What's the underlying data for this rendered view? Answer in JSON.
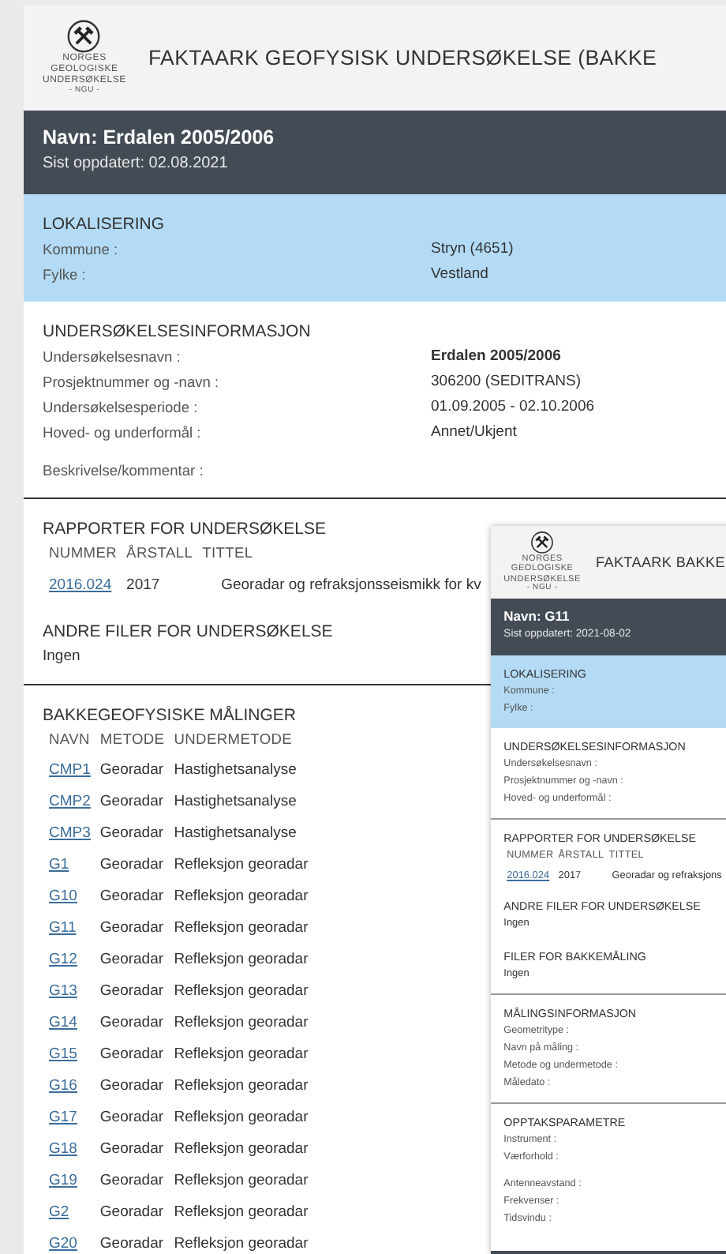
{
  "header": {
    "logo_lines": [
      "NORGES",
      "GEOLOGISKE",
      "UNDERSØKELSE",
      "- NGU -"
    ],
    "title": "FAKTAARK GEOFYSISK UNDERSØKELSE (BAKKE"
  },
  "name_bar": {
    "name": "Navn: Erdalen 2005/2006",
    "updated": "Sist oppdatert: 02.08.2021"
  },
  "location": {
    "heading": "LOKALISERING",
    "fields": [
      {
        "label": "Kommune :",
        "value": "Stryn (4651)",
        "bold": false
      },
      {
        "label": "Fylke :",
        "value": "Vestland",
        "bold": false
      }
    ]
  },
  "survey_info": {
    "heading": "UNDERSØKELSESINFORMASJON",
    "fields": [
      {
        "label": "Undersøkelsesnavn :",
        "value": "Erdalen 2005/2006",
        "bold": true
      },
      {
        "label": "Prosjektnummer og -navn :",
        "value": "306200 (SEDITRANS)",
        "bold": false
      },
      {
        "label": "Undersøkelsesperiode :",
        "value": "01.09.2005 - 02.10.2006",
        "bold": false
      },
      {
        "label": "Hoved- og underformål :",
        "value": "Annet/Ukjent",
        "bold": false
      }
    ],
    "description_label": "Beskrivelse/kommentar :"
  },
  "reports": {
    "heading": "RAPPORTER FOR UNDERSØKELSE",
    "columns": [
      "NUMMER",
      "ÅRSTALL",
      "TITTEL"
    ],
    "rows": [
      {
        "number": "2016.024",
        "year": "2017",
        "title": "Georadar og refraksjonsseismikk for kv"
      }
    ]
  },
  "other_files": {
    "heading": "ANDRE FILER FOR UNDERSØKELSE",
    "text": "Ingen"
  },
  "measurements": {
    "heading": "BAKKEGEOFYSISKE MÅLINGER",
    "columns": [
      "NAVN",
      "METODE",
      "UNDERMETODE"
    ],
    "rows": [
      {
        "name": "CMP1",
        "method": "Georadar",
        "submethod": "Hastighetsanalyse"
      },
      {
        "name": "CMP2",
        "method": "Georadar",
        "submethod": "Hastighetsanalyse"
      },
      {
        "name": "CMP3",
        "method": "Georadar",
        "submethod": "Hastighetsanalyse"
      },
      {
        "name": "G1",
        "method": "Georadar",
        "submethod": "Refleksjon georadar"
      },
      {
        "name": "G10",
        "method": "Georadar",
        "submethod": "Refleksjon georadar"
      },
      {
        "name": "G11",
        "method": "Georadar",
        "submethod": "Refleksjon georadar"
      },
      {
        "name": "G12",
        "method": "Georadar",
        "submethod": "Refleksjon georadar"
      },
      {
        "name": "G13",
        "method": "Georadar",
        "submethod": "Refleksjon georadar"
      },
      {
        "name": "G14",
        "method": "Georadar",
        "submethod": "Refleksjon georadar"
      },
      {
        "name": "G15",
        "method": "Georadar",
        "submethod": "Refleksjon georadar"
      },
      {
        "name": "G16",
        "method": "Georadar",
        "submethod": "Refleksjon georadar"
      },
      {
        "name": "G17",
        "method": "Georadar",
        "submethod": "Refleksjon georadar"
      },
      {
        "name": "G18",
        "method": "Georadar",
        "submethod": "Refleksjon georadar"
      },
      {
        "name": "G19",
        "method": "Georadar",
        "submethod": "Refleksjon georadar"
      },
      {
        "name": "G2",
        "method": "Georadar",
        "submethod": "Refleksjon georadar"
      },
      {
        "name": "G20",
        "method": "Georadar",
        "submethod": "Refleksjon georadar"
      }
    ]
  },
  "popup": {
    "logo_lines": [
      "NORGES",
      "GEOLOGISKE",
      "UNDERSØKELSE",
      "- NGU -"
    ],
    "title": "FAKTAARK BAKKE",
    "name": "Navn: G11",
    "updated": "Sist oppdatert: 2021-08-02",
    "location": {
      "heading": "LOKALISERING",
      "labels": [
        "Kommune :",
        "Fylke :"
      ]
    },
    "survey_info": {
      "heading": "UNDERSØKELSESINFORMASJON",
      "labels": [
        "Undersøkelsesnavn :",
        "Prosjektnummer og -navn :",
        "Hoved- og underformål :"
      ]
    },
    "reports": {
      "heading": "RAPPORTER FOR UNDERSØKELSE",
      "columns": [
        "NUMMER",
        "ÅRSTALL",
        "TITTEL"
      ],
      "rows": [
        {
          "number": "2016.024",
          "year": "2017",
          "title": "Georadar og refraksjons"
        }
      ]
    },
    "other_files": {
      "heading": "ANDRE FILER FOR UNDERSØKELSE",
      "text": "Ingen"
    },
    "measurement_files": {
      "heading": "FILER FOR BAKKEMÅLING",
      "text": "Ingen"
    },
    "measurement_info": {
      "heading": "MÅLINGSINFORMASJON",
      "labels": [
        "Geometritype :",
        "Navn på måling :",
        "Metode og undermetode :",
        "Måledato :"
      ]
    },
    "recording": {
      "heading": "OPPTAKSPARAMETRE",
      "groups": [
        [
          "Instrument :",
          "Værforhold :"
        ],
        [
          "Antenneavstand :",
          "Frekvenser :",
          "Tidsvindu :"
        ]
      ]
    }
  }
}
